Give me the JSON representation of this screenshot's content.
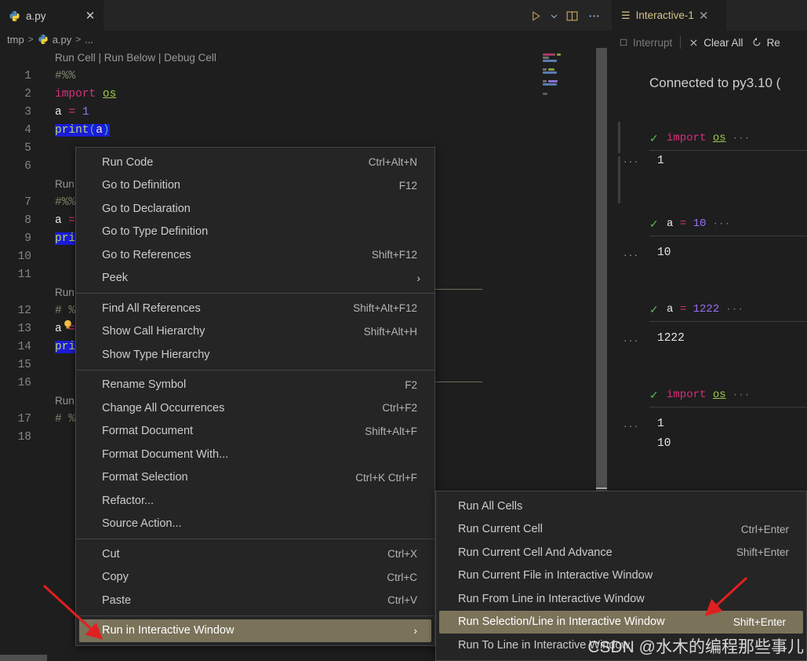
{
  "editor": {
    "tab": {
      "label": "a.py",
      "icon": "python-icon",
      "close_icon": "close-icon"
    },
    "actions": [
      {
        "name": "run-python-file-button",
        "icon": "play-icon"
      },
      {
        "name": "run-options-chevron",
        "icon": "chevron-down-icon"
      },
      {
        "name": "split-editor-button",
        "icon": "split-editor-icon"
      },
      {
        "name": "more-actions-button",
        "icon": "ellipsis-icon"
      }
    ],
    "breadcrumb": {
      "root": "tmp",
      "file": "a.py",
      "more": "...",
      "separator": ">"
    },
    "codelens": {
      "run_cell": "Run Cell",
      "run_below": "Run Below",
      "debug_cell": "Debug Cell",
      "full": "Run Cell | Run Below | Debug Cell"
    },
    "lines": [
      {
        "n": 1,
        "text": "#%%"
      },
      {
        "n": 2,
        "text": "import os"
      },
      {
        "n": 3,
        "text": "a = 1"
      },
      {
        "n": 4,
        "text": "print(a)"
      },
      {
        "n": 5,
        "text": ""
      },
      {
        "n": 6,
        "text": ""
      },
      {
        "n": 7,
        "text": "#%%"
      },
      {
        "n": 8,
        "text": "a = "
      },
      {
        "n": 9,
        "text": "pri"
      },
      {
        "n": 10,
        "text": ""
      },
      {
        "n": 11,
        "text": ""
      },
      {
        "n": 12,
        "text": "# %"
      },
      {
        "n": 13,
        "text": "a ="
      },
      {
        "n": 14,
        "text": "pri"
      },
      {
        "n": 15,
        "text": ""
      },
      {
        "n": 16,
        "text": ""
      },
      {
        "n": 17,
        "text": "# %"
      },
      {
        "n": 18,
        "text": ""
      }
    ]
  },
  "context_menu": {
    "groups": [
      [
        {
          "label": "Run Code",
          "keybinding": "Ctrl+Alt+N"
        },
        {
          "label": "Go to Definition",
          "keybinding": "F12"
        },
        {
          "label": "Go to Declaration",
          "keybinding": ""
        },
        {
          "label": "Go to Type Definition",
          "keybinding": ""
        },
        {
          "label": "Go to References",
          "keybinding": "Shift+F12"
        },
        {
          "label": "Peek",
          "keybinding": "",
          "submenu": true
        }
      ],
      [
        {
          "label": "Find All References",
          "keybinding": "Shift+Alt+F12"
        },
        {
          "label": "Show Call Hierarchy",
          "keybinding": "Shift+Alt+H"
        },
        {
          "label": "Show Type Hierarchy",
          "keybinding": ""
        }
      ],
      [
        {
          "label": "Rename Symbol",
          "keybinding": "F2"
        },
        {
          "label": "Change All Occurrences",
          "keybinding": "Ctrl+F2"
        },
        {
          "label": "Format Document",
          "keybinding": "Shift+Alt+F"
        },
        {
          "label": "Format Document With...",
          "keybinding": ""
        },
        {
          "label": "Format Selection",
          "keybinding": "Ctrl+K Ctrl+F"
        },
        {
          "label": "Refactor...",
          "keybinding": ""
        },
        {
          "label": "Source Action...",
          "keybinding": ""
        }
      ],
      [
        {
          "label": "Cut",
          "keybinding": "Ctrl+X"
        },
        {
          "label": "Copy",
          "keybinding": "Ctrl+C"
        },
        {
          "label": "Paste",
          "keybinding": "Ctrl+V"
        }
      ],
      [
        {
          "label": "Run in Interactive Window",
          "keybinding": "",
          "submenu": true,
          "selected": true
        }
      ]
    ]
  },
  "submenu": {
    "items": [
      {
        "label": "Run All Cells",
        "keybinding": ""
      },
      {
        "label": "Run Current Cell",
        "keybinding": "Ctrl+Enter"
      },
      {
        "label": "Run Current Cell And Advance",
        "keybinding": "Shift+Enter"
      },
      {
        "label": "Run Current File in Interactive Window",
        "keybinding": ""
      },
      {
        "label": "Run From Line in Interactive Window",
        "keybinding": ""
      },
      {
        "label": "Run Selection/Line in Interactive Window",
        "keybinding": "Shift+Enter",
        "selected": true
      },
      {
        "label": "Run To Line in Interactive Window",
        "keybinding": ""
      }
    ]
  },
  "interactive_window": {
    "tab": {
      "label": "Interactive-1",
      "icon": "notebook-icon",
      "close_icon": "close-icon"
    },
    "toolbar": {
      "interrupt": "Interrupt",
      "clear_all": "Clear All",
      "restart": "Re",
      "interrupt_icon": "stop-square-icon",
      "clear_all_icon": "close-icon",
      "restart_icon": "restart-icon"
    },
    "connected_text": "Connected to py3.10 (",
    "cells": [
      {
        "input": "import os",
        "ellipsis": "···",
        "status": "success",
        "outputs": [
          "1"
        ]
      },
      {
        "input": "a = 10",
        "ellipsis": "···",
        "status": "success",
        "outputs": [
          "10"
        ]
      },
      {
        "input": "a = 1222",
        "ellipsis": "···",
        "status": "success",
        "outputs": [
          "1222"
        ]
      },
      {
        "input": "import os",
        "ellipsis": "···",
        "status": "success",
        "outputs": [
          "1",
          "10"
        ]
      }
    ],
    "cell_more_icon": "ellipsis-icon"
  },
  "watermark": {
    "text": "CSDN @水木的编程那些事儿"
  },
  "annotations": [
    {
      "name": "arrow-to-run-in-interactive-window",
      "color": "#e02020"
    },
    {
      "name": "arrow-to-run-selection-line",
      "color": "#e02020"
    }
  ],
  "colors": {
    "editor_bg": "#1e1e1e",
    "menu_bg": "#252526",
    "menu_selected": "#7a7259",
    "selection_blue": "#1c1cd8",
    "accent_yellow": "#d6c189",
    "success_green": "#5aba5a",
    "arrow_red": "#e02020"
  }
}
